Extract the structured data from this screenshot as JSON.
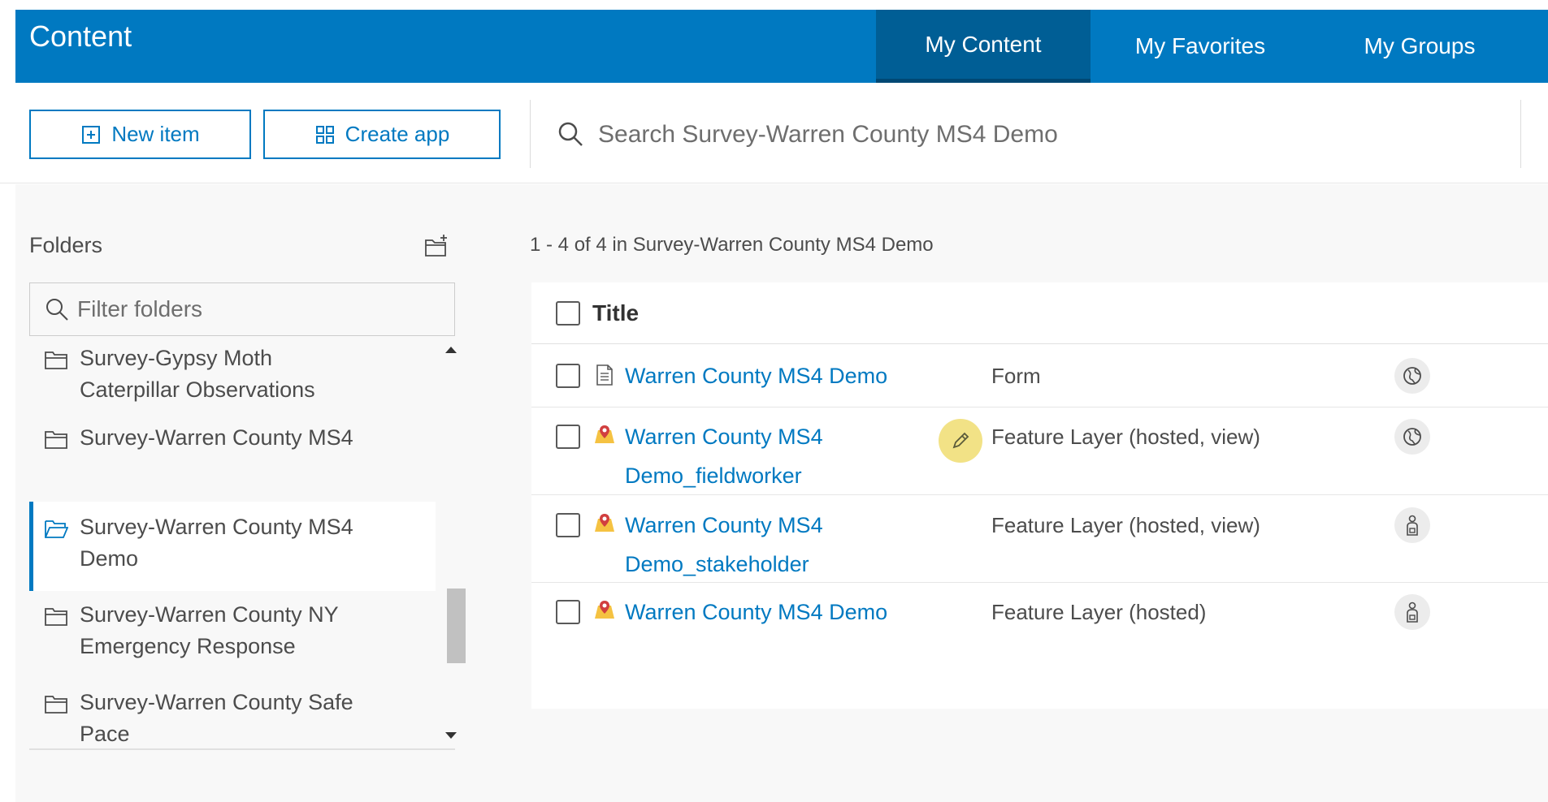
{
  "header": {
    "title": "Content",
    "tabs": [
      {
        "label": "My Content",
        "active": true
      },
      {
        "label": "My Favorites",
        "active": false
      },
      {
        "label": "My Groups",
        "active": false
      }
    ]
  },
  "toolbar": {
    "new_item_label": "New item",
    "create_app_label": "Create app",
    "search_placeholder": "Search Survey-Warren County MS4 Demo"
  },
  "sidebar": {
    "title": "Folders",
    "filter_placeholder": "Filter folders",
    "folders": [
      {
        "label": "Survey-Gypsy Moth Caterpillar Observations",
        "active": false
      },
      {
        "label": "Survey-Warren County MS4",
        "active": false
      },
      {
        "label": "Survey-Warren County MS4 Demo",
        "active": true
      },
      {
        "label": "Survey-Warren County NY Emergency Response",
        "active": false
      },
      {
        "label": "Survey-Warren County Safe Pace",
        "active": false
      }
    ]
  },
  "main": {
    "results_count": "1 - 4 of 4 in Survey-Warren County MS4 Demo",
    "columns": {
      "title": "Title"
    },
    "rows": [
      {
        "title": "Warren County MS4 Demo",
        "type": "Form",
        "icon": "form-icon",
        "sharing": "public-globe-icon"
      },
      {
        "title": "Warren County MS4 Demo_fieldworker",
        "type": "Feature Layer (hosted, view)",
        "icon": "feature-layer-icon",
        "sharing": "public-globe-icon"
      },
      {
        "title": "Warren County MS4 Demo_stakeholder",
        "type": "Feature Layer (hosted, view)",
        "icon": "feature-layer-icon",
        "sharing": "private-user-icon"
      },
      {
        "title": "Warren County MS4 Demo",
        "type": "Feature Layer (hosted)",
        "icon": "feature-layer-icon",
        "sharing": "private-user-icon"
      }
    ]
  },
  "colors": {
    "brand": "#0079c1",
    "brand_dark": "#005e95",
    "edit_highlight": "#f2e286"
  }
}
